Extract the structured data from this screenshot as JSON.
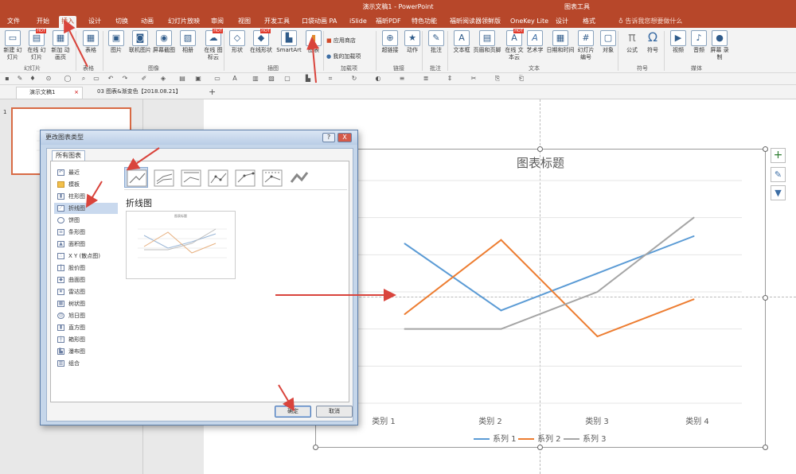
{
  "titlebar": {
    "app_title": "演示文稿1 - PowerPoint",
    "context_title": "图表工具"
  },
  "tabs": [
    "文件",
    "开始",
    "插入",
    "设计",
    "切换",
    "动画",
    "幻灯片放映",
    "审阅",
    "视图",
    "开发工具",
    "口袋动画 PA",
    "iSlide",
    "福昕PDF",
    "特色功能",
    "福昕阅读器领鲜版",
    "OneKey Lite",
    "设计",
    "格式"
  ],
  "search_hint": "告诉我您想要做什么",
  "ribbon": {
    "buttons": [
      {
        "label": "新建\n幻灯片",
        "icon": "new-slide-icon"
      },
      {
        "label": "在线\n幻灯片",
        "icon": "online-slide-icon",
        "hot": "HOT"
      },
      {
        "label": "新加\n动画页",
        "icon": "animation-page-icon"
      },
      {
        "label": "表格",
        "icon": "table-icon"
      },
      {
        "label": "图片",
        "icon": "picture-icon"
      },
      {
        "label": "联机图片",
        "icon": "online-picture-icon"
      },
      {
        "label": "屏幕截图",
        "icon": "screenshot-icon"
      },
      {
        "label": "相册",
        "icon": "album-icon"
      },
      {
        "label": "在线\n图标云",
        "icon": "icon-cloud-icon",
        "hot": "HOT"
      },
      {
        "label": "形状",
        "icon": "shapes-icon"
      },
      {
        "label": "在线形状",
        "icon": "online-shapes-icon",
        "hot": "HOT"
      },
      {
        "label": "SmartArt",
        "icon": "smartart-icon"
      },
      {
        "label": "图表",
        "icon": "chart-icon"
      },
      {
        "label": "超链接",
        "icon": "hyperlink-icon"
      },
      {
        "label": "动作",
        "icon": "action-icon"
      },
      {
        "label": "批注",
        "icon": "comment-icon"
      },
      {
        "label": "文本框",
        "icon": "textbox-icon"
      },
      {
        "label": "页眉和页脚",
        "icon": "header-footer-icon"
      },
      {
        "label": "在线\n文本云",
        "icon": "text-cloud-icon",
        "hot": "HOT"
      },
      {
        "label": "艺术字",
        "icon": "wordart-icon"
      },
      {
        "label": "日期和时间",
        "icon": "date-time-icon"
      },
      {
        "label": "幻灯片\n编号",
        "icon": "slide-number-icon"
      },
      {
        "label": "对象",
        "icon": "object-icon"
      },
      {
        "label": "公式",
        "icon": "equation-icon"
      },
      {
        "label": "符号",
        "icon": "symbol-icon"
      },
      {
        "label": "视频",
        "icon": "video-icon"
      },
      {
        "label": "音频",
        "icon": "audio-icon"
      },
      {
        "label": "屏幕\n录制",
        "icon": "screen-record-icon"
      }
    ],
    "addins": [
      "应用商店",
      "我的加载项"
    ],
    "groups": [
      "幻灯片",
      "表格",
      "图像",
      "插图",
      "加载项",
      "链接",
      "批注",
      "文本",
      "符号",
      "媒体"
    ]
  },
  "doc_tabs": [
    {
      "label": "演示文稿1",
      "active": true
    },
    {
      "label": "03 图表&渐变色【2018.08.21】",
      "active": false
    }
  ],
  "dialog": {
    "title": "更改图表类型",
    "tab": "所有图表",
    "categories": [
      "最近",
      "模板",
      "柱形图",
      "折线图",
      "饼图",
      "条形图",
      "面积图",
      "X Y (散点图)",
      "股价图",
      "曲面图",
      "雷达图",
      "树状图",
      "旭日图",
      "直方图",
      "箱形图",
      "瀑布图",
      "组合"
    ],
    "selected_category": 3,
    "type_label": "折线图",
    "preview_title": "图表标题",
    "ok": "确定",
    "cancel": "取消",
    "help": "?",
    "close": "X"
  },
  "chart_data": {
    "type": "line",
    "title": "图表标题",
    "categories": [
      "类别 1",
      "类别 2",
      "类别 3",
      "类别 4"
    ],
    "ylim": [
      0,
      6
    ],
    "grid": true,
    "legend_position": "bottom",
    "series": [
      {
        "name": "系列 1",
        "values": [
          4.3,
          2.5,
          3.5,
          4.5
        ],
        "color": "#5b9bd5"
      },
      {
        "name": "系列 2",
        "values": [
          2.4,
          4.4,
          1.8,
          2.8
        ],
        "color": "#ed7d31"
      },
      {
        "name": "系列 3",
        "values": [
          2.0,
          2.0,
          3.0,
          5.0
        ],
        "color": "#a5a5a5"
      }
    ]
  },
  "colors": {
    "accent": "#b7472a",
    "arrow": "#d9443c"
  }
}
